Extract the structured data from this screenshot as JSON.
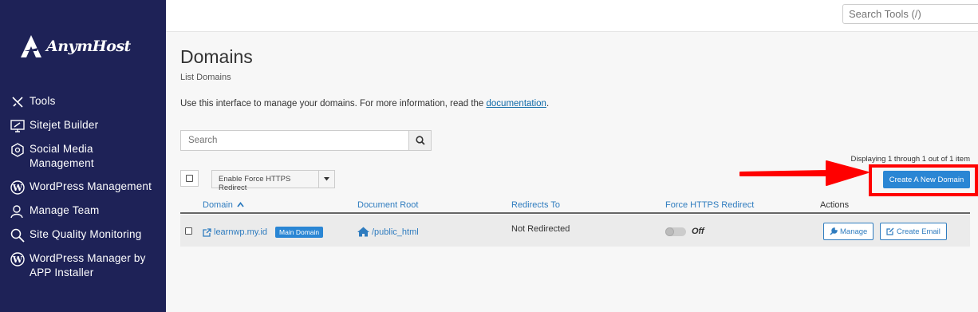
{
  "sidebar": {
    "logo_text": "AnymHost",
    "items": [
      {
        "label": "Tools",
        "icon": "tools-icon"
      },
      {
        "label": "Sitejet Builder",
        "icon": "sitejet-icon"
      },
      {
        "label": "Social Media Management",
        "icon": "social-media-icon"
      },
      {
        "label": "WordPress Management",
        "icon": "wordpress-icon"
      },
      {
        "label": "Manage Team",
        "icon": "team-icon"
      },
      {
        "label": "Site Quality Monitoring",
        "icon": "quality-search-icon"
      },
      {
        "label": "WordPress Manager by APP Installer",
        "icon": "wordpress-icon"
      }
    ]
  },
  "topbar": {
    "search_placeholder": "Search Tools (/)"
  },
  "page": {
    "title": "Domains",
    "subtitle": "List Domains",
    "description": "Use this interface to manage your domains. For more information, read the ",
    "description_link": "documentation",
    "description_end": "."
  },
  "search": {
    "placeholder": "Search"
  },
  "toolbar": {
    "bulk_action_label": "Enable Force HTTPS Redirect",
    "display_count": "Displaying 1 through 1 out of 1 item",
    "create_label": "Create A New Domain"
  },
  "table": {
    "headers": {
      "domain": "Domain",
      "document_root": "Document Root",
      "redirects_to": "Redirects To",
      "force_https": "Force HTTPS Redirect",
      "actions": "Actions"
    },
    "rows": [
      {
        "domain": "learnwp.my.id",
        "badge": "Main Domain",
        "document_root": "/public_html",
        "redirects_to": "Not Redirected",
        "force_https": "Off",
        "manage_label": "Manage",
        "email_label": "Create Email"
      }
    ]
  },
  "colors": {
    "sidebar_bg": "#1e2257",
    "accent": "#2a86d4",
    "link": "#2f7cbf",
    "annotation": "#ff0000"
  }
}
